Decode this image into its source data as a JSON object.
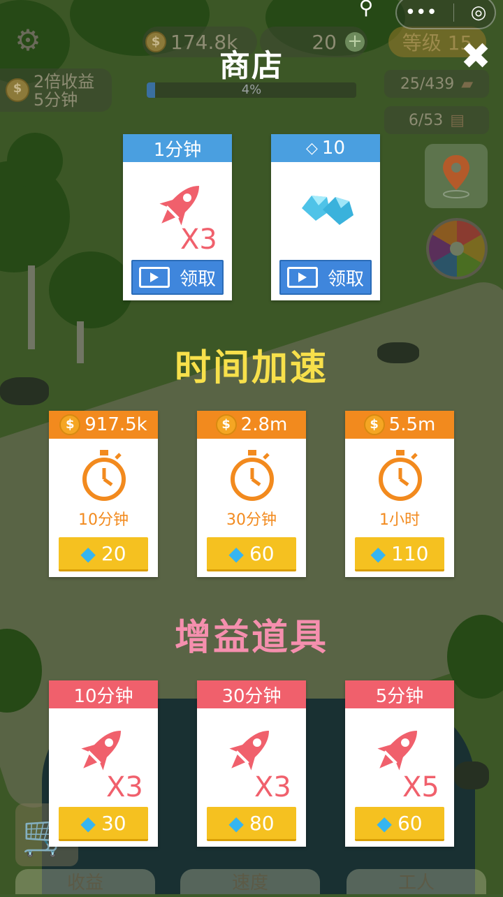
{
  "hud": {
    "coins": "174.8k",
    "gems": "20",
    "level": "等级 15",
    "bonus_line1": "2倍收益",
    "bonus_line2": "5分钟",
    "progress_text": "4%",
    "progress_value": 0.04,
    "wood": "25/439",
    "planks": "6/53"
  },
  "shop": {
    "title": "商店"
  },
  "free_offers": [
    {
      "header": "1分钟",
      "multiplier": "X3",
      "button": "领取"
    },
    {
      "header": "10",
      "button": "领取"
    }
  ],
  "time_boost": {
    "title": "时间加速",
    "items": [
      {
        "price": "917.5k",
        "duration": "10分钟",
        "gems": "20"
      },
      {
        "price": "2.8m",
        "duration": "30分钟",
        "gems": "60"
      },
      {
        "price": "5.5m",
        "duration": "1小时",
        "gems": "110"
      }
    ]
  },
  "boosters": {
    "title": "增益道具",
    "items": [
      {
        "header": "10分钟",
        "multiplier": "X3",
        "gems": "30"
      },
      {
        "header": "30分钟",
        "multiplier": "X3",
        "gems": "80"
      },
      {
        "header": "5分钟",
        "multiplier": "X5",
        "gems": "60"
      }
    ]
  },
  "bottom_tabs": [
    "收益",
    "速度",
    "工人"
  ],
  "colors": {
    "blue_header": "#4a9fe0",
    "orange_header": "#f28a1e",
    "pink_header": "#f0606c",
    "gem_button": "#f5c120",
    "video_button": "#3f86dc",
    "section_yellow": "#f7e04b",
    "section_pink": "#f58fae"
  }
}
